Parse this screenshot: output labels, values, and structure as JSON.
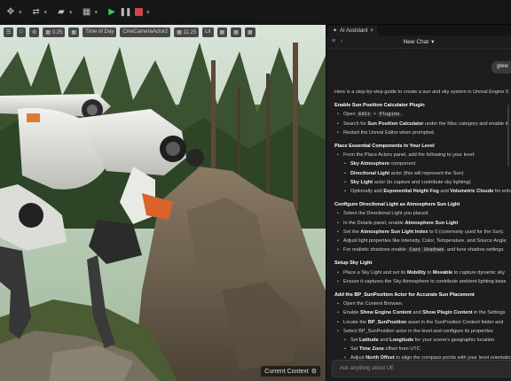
{
  "toolbar": {
    "items": [
      "move-icon",
      "transform-icon",
      "camera-icon",
      "build-icon",
      "play",
      "pause",
      "stop"
    ]
  },
  "viewport": {
    "buttons": [
      "☰",
      "□",
      "⚙",
      "▦ 0.25",
      "▦",
      "Time of Day",
      "CineCameraActor2",
      "▦ 11.25",
      "Lit",
      "▦",
      "▦",
      "▦"
    ],
    "status_label": "Current Context"
  },
  "assistant": {
    "tab_label": "AI Assistant",
    "header_label": "New Chat",
    "user_message": "gtew",
    "intro": "Here is a step-by-step guide to create a sun and sky system in Unreal Engine 5",
    "sections": [
      {
        "heading": "Enable Sun Position Calculator Plugin",
        "items": [
          {
            "level": 1,
            "parts": [
              {
                "t": "Open "
              },
              {
                "c": "Edit"
              },
              {
                "t": " > "
              },
              {
                "c": "Plugins"
              },
              {
                "t": "."
              }
            ]
          },
          {
            "level": 1,
            "parts": [
              {
                "t": "Search for "
              },
              {
                "b": "Sun Position Calculator"
              },
              {
                "t": " under the Misc category and enable it."
              }
            ]
          },
          {
            "level": 1,
            "parts": [
              {
                "t": "Restart the Unreal Editor when prompted."
              }
            ]
          }
        ]
      },
      {
        "heading": "Place Essential Components In Your Level",
        "items": [
          {
            "level": 1,
            "parts": [
              {
                "t": "From the Place Actors panel, add the following to your level:"
              }
            ]
          },
          {
            "level": 2,
            "parts": [
              {
                "b": "Sky Atmosphere"
              },
              {
                "t": " component"
              }
            ]
          },
          {
            "level": 2,
            "parts": [
              {
                "b": "Directional Light"
              },
              {
                "t": " actor (this will represent the Sun)"
              }
            ]
          },
          {
            "level": 2,
            "parts": [
              {
                "b": "Sky Light"
              },
              {
                "t": " actor (to capture and contribute sky lighting)"
              }
            ]
          },
          {
            "level": 2,
            "parts": [
              {
                "t": "Optionally add "
              },
              {
                "b": "Exponential Height Fog"
              },
              {
                "t": " and "
              },
              {
                "b": "Volumetric Clouds"
              },
              {
                "t": " for enhanced"
              }
            ]
          }
        ]
      },
      {
        "heading": "Configure Directional Light as Atmosphere Sun Light",
        "items": [
          {
            "level": 1,
            "parts": [
              {
                "t": "Select the Directional Light you placed."
              }
            ]
          },
          {
            "level": 1,
            "parts": [
              {
                "t": "In the Details panel, enable "
              },
              {
                "b": "Atmosphere Sun Light"
              }
            ]
          },
          {
            "level": 1,
            "parts": [
              {
                "t": "Set the "
              },
              {
                "b": "Atmosphere Sun Light Index"
              },
              {
                "t": " to 0 (commonly used for the Sun)."
              }
            ]
          },
          {
            "level": 1,
            "parts": [
              {
                "t": "Adjust light properties like Intensity, Color, Temperature, and Source Angle"
              }
            ]
          },
          {
            "level": 1,
            "parts": [
              {
                "t": "For realistic shadows enable "
              },
              {
                "c": "Cast Shadows"
              },
              {
                "t": " and tune shadow settings."
              }
            ]
          }
        ]
      },
      {
        "heading": "Setup Sky Light",
        "items": [
          {
            "level": 1,
            "parts": [
              {
                "t": "Place a Sky Light and set its "
              },
              {
                "b": "Mobility"
              },
              {
                "t": " to "
              },
              {
                "b": "Movable"
              },
              {
                "t": " to capture dynamic sky"
              }
            ]
          },
          {
            "level": 1,
            "parts": [
              {
                "t": "Ensure it captures the Sky Atmosphere to contribute ambient lighting base"
              }
            ]
          }
        ]
      },
      {
        "heading": "Add the BP_SunPosition Actor for Accurate Sun Placement",
        "items": [
          {
            "level": 1,
            "parts": [
              {
                "t": "Open the Content Browser."
              }
            ]
          },
          {
            "level": 1,
            "parts": [
              {
                "t": "Enable "
              },
              {
                "b": "Show Engine Content"
              },
              {
                "t": " and "
              },
              {
                "b": "Show Plugin Content"
              },
              {
                "t": " in the Settings"
              }
            ]
          },
          {
            "level": 1,
            "parts": [
              {
                "t": "Locate the "
              },
              {
                "b": "BP_SunPosition"
              },
              {
                "t": " asset in the SunPosition Content folder and"
              }
            ]
          },
          {
            "level": 1,
            "parts": [
              {
                "t": "Select BP_SunPosition actor in the level and configure its properties"
              }
            ]
          },
          {
            "level": 2,
            "parts": [
              {
                "t": "Set "
              },
              {
                "b": "Latitude"
              },
              {
                "t": " and "
              },
              {
                "b": "Longitude"
              },
              {
                "t": " for your scene's geographic location"
              }
            ]
          },
          {
            "level": 2,
            "parts": [
              {
                "t": "Set "
              },
              {
                "b": "Time Zone"
              },
              {
                "t": " offset from UTC"
              }
            ]
          },
          {
            "level": 2,
            "parts": [
              {
                "t": "Adjust "
              },
              {
                "b": "North Offset"
              },
              {
                "t": " to align the compass points with your level orientation"
              }
            ]
          },
          {
            "level": 2,
            "parts": [
              {
                "t": "Set the "
              },
              {
                "b": "Date"
              },
              {
                "t": " and "
              },
              {
                "b": "Time"
              },
              {
                "t": " to simulate the specific sun position"
              }
            ]
          }
        ]
      }
    ],
    "input_placeholder": "Ask anything about UE"
  }
}
